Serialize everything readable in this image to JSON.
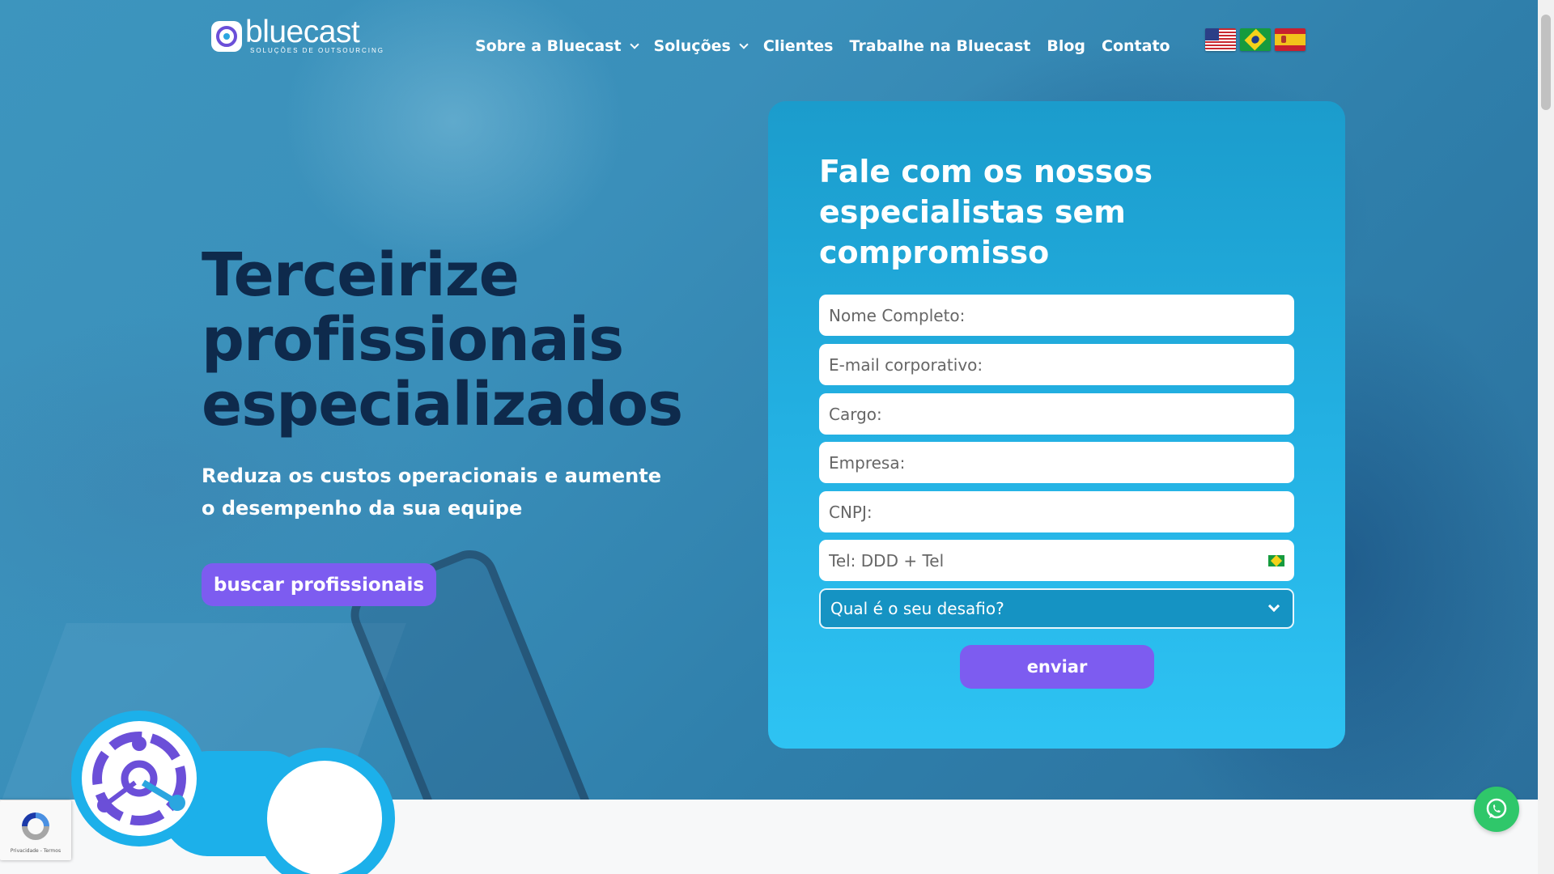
{
  "header": {
    "logo_name": "bluecast",
    "logo_tagline": "SOLUÇÕES DE OUTSOURCING",
    "nav": [
      {
        "label": "Sobre a Bluecast",
        "has_dropdown": true
      },
      {
        "label": "Soluções",
        "has_dropdown": true
      },
      {
        "label": "Clientes",
        "has_dropdown": false
      },
      {
        "label": "Trabalhe na Bluecast",
        "has_dropdown": false
      },
      {
        "label": "Blog",
        "has_dropdown": false
      },
      {
        "label": "Contato",
        "has_dropdown": false
      }
    ],
    "flags": [
      "us-flag-icon",
      "brazil-flag-icon",
      "spain-flag-icon"
    ]
  },
  "hero": {
    "headline": "Terceirize profissionais especializados",
    "subheadline": "Reduza os custos operacionais e aumente o desempenho da sua equipe",
    "cta_label": "buscar profissionais"
  },
  "form": {
    "title": "Fale com os nossos especialistas sem compromisso",
    "fields": {
      "name_placeholder": "Nome Completo:",
      "email_placeholder": "E-mail corporativo:",
      "role_placeholder": "Cargo:",
      "company_placeholder": "Empresa:",
      "cnpj_placeholder": "CNPJ:",
      "phone_placeholder": "Tel: DDD + Tel"
    },
    "challenge_select": "Qual é o seu desafio?",
    "submit_label": "enviar"
  },
  "recaptcha": {
    "text": "Privacidade - Termos"
  },
  "colors": {
    "accent_purple": "#7d5cf0",
    "card_blue": "#23b0e2",
    "headline_navy": "#0e2a4c",
    "whatsapp_green": "#2fc76a"
  }
}
